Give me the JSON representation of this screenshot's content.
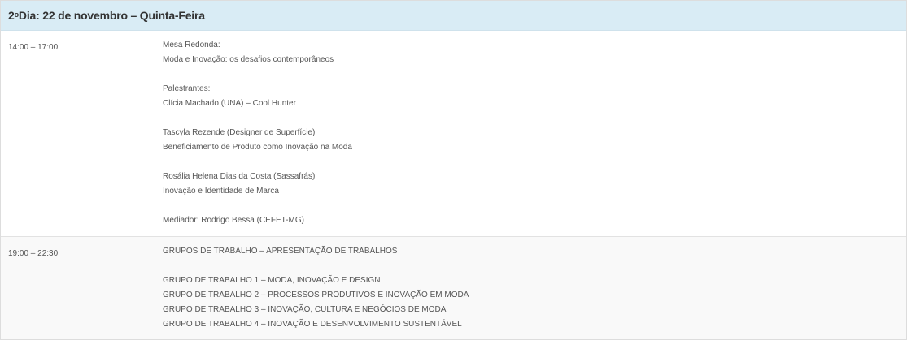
{
  "header": {
    "day_number": "2",
    "day_ordinal": "o",
    "day_rest": " Dia: 22 de novembro – Quinta-Feira"
  },
  "rows": [
    {
      "time": "14:00 – 17:00",
      "blocks": [
        [
          "Mesa Redonda:",
          "Moda e Inovação: os desafios contemporâneos"
        ],
        [
          "Palestrantes:",
          "Clícia Machado (UNA) – Cool Hunter"
        ],
        [
          "Tascyla Rezende (Designer de Superfície)",
          "Beneficiamento de Produto como Inovação na Moda"
        ],
        [
          "Rosália Helena Dias da Costa (Sassafrás)",
          "Inovação e Identidade de Marca"
        ],
        [
          "Mediador: Rodrigo Bessa (CEFET-MG)"
        ]
      ]
    },
    {
      "time": "19:00 – 22:30",
      "blocks": [
        [
          "GRUPOS DE TRABALHO – APRESENTAÇÃO DE TRABALHOS"
        ],
        [
          "GRUPO DE TRABALHO 1 – MODA, INOVAÇÃO E DESIGN",
          "GRUPO DE TRABALHO 2 – PROCESSOS PRODUTIVOS E INOVAÇÃO EM MODA",
          "GRUPO DE TRABALHO 3 – INOVAÇÃO, CULTURA E NEGÓCIOS DE MODA",
          "GRUPO DE TRABALHO 4 – INOVAÇÃO E DESENVOLVIMENTO SUSTENTÁVEL"
        ]
      ]
    }
  ]
}
